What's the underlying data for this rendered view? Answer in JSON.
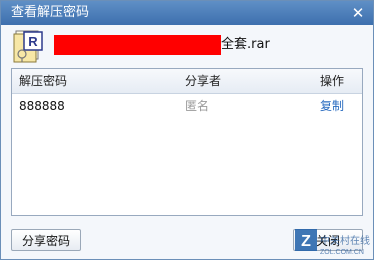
{
  "window": {
    "title": "查看解压密码",
    "close_glyph": "✕"
  },
  "file": {
    "name_suffix": "全套.rar",
    "icon": "rar-file-icon",
    "icon_letter": "R"
  },
  "table": {
    "headers": [
      "解压密码",
      "分享者",
      "操作"
    ],
    "rows": [
      {
        "password": "888888",
        "sharer": "匿名",
        "action": "复制"
      }
    ]
  },
  "buttons": {
    "share_password": "分享密码",
    "close": "关闭"
  },
  "watermark": {
    "cn": "中关村在线",
    "en": "ZOL.COM.CN",
    "logo_letter": "Z"
  },
  "colors": {
    "titlebar": "#4a7bb8",
    "link": "#2a6cc0",
    "redaction": "#ff0000"
  }
}
